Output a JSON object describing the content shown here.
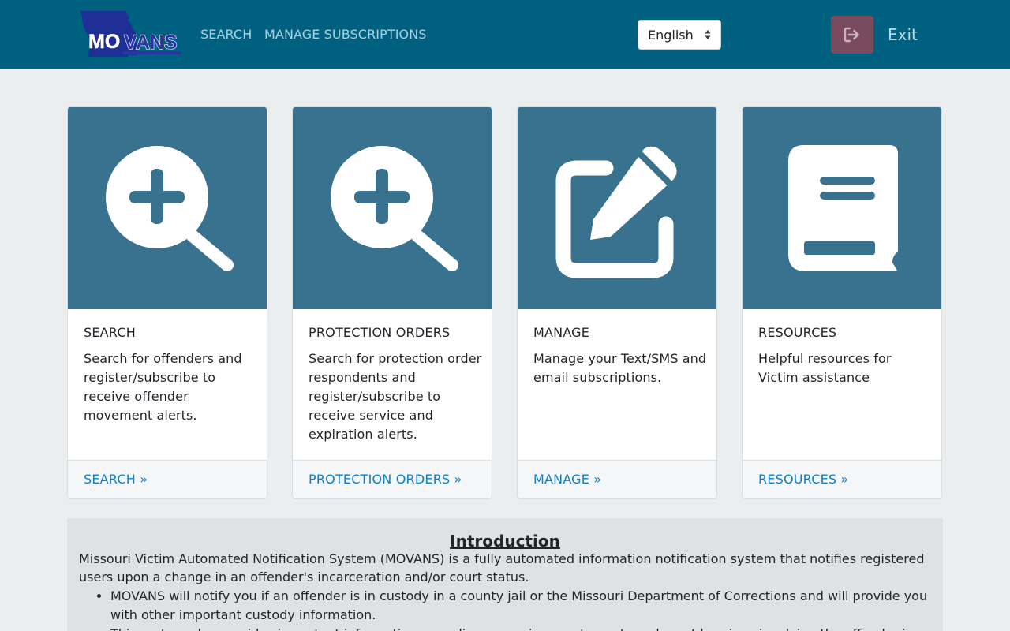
{
  "header": {
    "logo_text": "MOVANS",
    "nav": [
      {
        "label": "SEARCH"
      },
      {
        "label": "MANAGE SUBSCRIPTIONS"
      }
    ],
    "language": {
      "selected": "English"
    },
    "exit": {
      "label": "Exit",
      "icon": "sign-out-icon"
    }
  },
  "cards": [
    {
      "icon": "magnifier-plus-icon",
      "title": "SEARCH",
      "text": "Search for offenders and register/subscribe to receive offender movement alerts.",
      "link": "SEARCH »"
    },
    {
      "icon": "magnifier-plus-icon",
      "title": "PROTECTION ORDERS",
      "text": "Search for protection order respondents and register/subscribe to receive service and expiration alerts.",
      "link": "PROTECTION ORDERS »"
    },
    {
      "icon": "edit-pencil-icon",
      "title": "MANAGE",
      "text": "Manage your Text/SMS and email subscriptions.",
      "link": "MANAGE »"
    },
    {
      "icon": "book-icon",
      "title": "RESOURCES",
      "text": "Helpful resources for Victim assistance",
      "link": "RESOURCES »"
    }
  ],
  "intro": {
    "title": "Introduction",
    "paragraph": "Missouri Victim Automated Notification System (MOVANS) is a fully automated information notification system that notifies registered users upon a change in an offender's incarceration and/or court status.",
    "bullets": [
      "MOVANS will notify you if an offender is in custody in a county jail or the Missouri Department of Corrections and will provide you with other important custody information.",
      "This system also provides important information regarding upcoming court events and court hearings involving the offender in"
    ]
  },
  "colors": {
    "navbar": "#006080",
    "card_image": "#39728f",
    "link": "#0b7fcb",
    "exit_button": "#7a4b5e"
  }
}
